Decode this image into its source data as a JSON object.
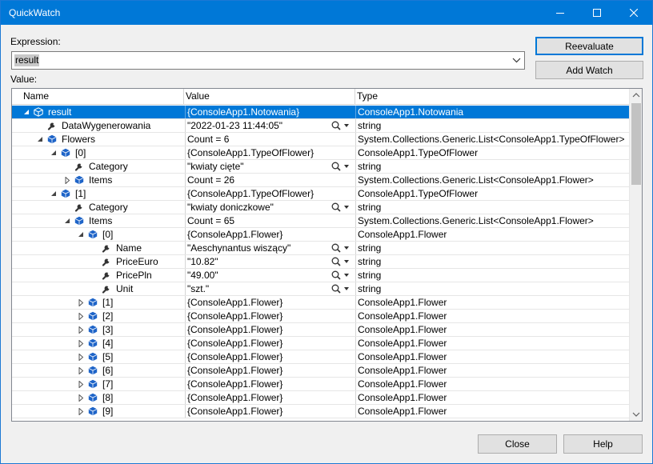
{
  "window": {
    "title": "QuickWatch"
  },
  "titlebar_icons": [
    "minimize-icon",
    "maximize-icon",
    "close-icon"
  ],
  "expression": {
    "label": "Expression:",
    "value": "result"
  },
  "value_label": "Value:",
  "buttons": {
    "reevaluate": "Reevaluate",
    "add_watch": "Add Watch",
    "close": "Close",
    "help": "Help"
  },
  "columns": {
    "name": "Name",
    "value": "Value",
    "type": "Type"
  },
  "colors": {
    "accent": "#0078d7",
    "field_icon": "#1e64c8"
  },
  "rows": [
    {
      "name": "result",
      "value": "{ConsoleApp1.Notowania}",
      "type": "ConsoleApp1.Notowania",
      "level": 0,
      "expander": "expanded",
      "icon": "object",
      "selected": true
    },
    {
      "name": "DataWygenerowania",
      "value": "\"2022-01-23 11:44:05\"",
      "type": "string",
      "level": 1,
      "expander": "none",
      "icon": "property",
      "magnifier": true
    },
    {
      "name": "Flowers",
      "value": "Count = 6",
      "type": "System.Collections.Generic.List<ConsoleApp1.TypeOfFlower>",
      "level": 1,
      "expander": "expanded",
      "icon": "field"
    },
    {
      "name": "[0]",
      "value": "{ConsoleApp1.TypeOfFlower}",
      "type": "ConsoleApp1.TypeOfFlower",
      "level": 2,
      "expander": "expanded",
      "icon": "field"
    },
    {
      "name": "Category",
      "value": "\"kwiaty cięte\"",
      "type": "string",
      "level": 3,
      "expander": "none",
      "icon": "property",
      "magnifier": true
    },
    {
      "name": "Items",
      "value": "Count = 26",
      "type": "System.Collections.Generic.List<ConsoleApp1.Flower>",
      "level": 3,
      "expander": "collapsed",
      "icon": "field"
    },
    {
      "name": "[1]",
      "value": "{ConsoleApp1.TypeOfFlower}",
      "type": "ConsoleApp1.TypeOfFlower",
      "level": 2,
      "expander": "expanded",
      "icon": "field"
    },
    {
      "name": "Category",
      "value": "\"kwiaty doniczkowe\"",
      "type": "string",
      "level": 3,
      "expander": "none",
      "icon": "property",
      "magnifier": true
    },
    {
      "name": "Items",
      "value": "Count = 65",
      "type": "System.Collections.Generic.List<ConsoleApp1.Flower>",
      "level": 3,
      "expander": "expanded",
      "icon": "field"
    },
    {
      "name": "[0]",
      "value": "{ConsoleApp1.Flower}",
      "type": "ConsoleApp1.Flower",
      "level": 4,
      "expander": "expanded",
      "icon": "field"
    },
    {
      "name": "Name",
      "value": "\"Aeschynantus wiszący\"",
      "type": "string",
      "level": 5,
      "expander": "none",
      "icon": "property",
      "magnifier": true
    },
    {
      "name": "PriceEuro",
      "value": "\"10.82\"",
      "type": "string",
      "level": 5,
      "expander": "none",
      "icon": "property",
      "magnifier": true
    },
    {
      "name": "PricePln",
      "value": "\"49.00\"",
      "type": "string",
      "level": 5,
      "expander": "none",
      "icon": "property",
      "magnifier": true
    },
    {
      "name": "Unit",
      "value": "\"szt.\"",
      "type": "string",
      "level": 5,
      "expander": "none",
      "icon": "property",
      "magnifier": true
    },
    {
      "name": "[1]",
      "value": "{ConsoleApp1.Flower}",
      "type": "ConsoleApp1.Flower",
      "level": 4,
      "expander": "collapsed",
      "icon": "field"
    },
    {
      "name": "[2]",
      "value": "{ConsoleApp1.Flower}",
      "type": "ConsoleApp1.Flower",
      "level": 4,
      "expander": "collapsed",
      "icon": "field"
    },
    {
      "name": "[3]",
      "value": "{ConsoleApp1.Flower}",
      "type": "ConsoleApp1.Flower",
      "level": 4,
      "expander": "collapsed",
      "icon": "field"
    },
    {
      "name": "[4]",
      "value": "{ConsoleApp1.Flower}",
      "type": "ConsoleApp1.Flower",
      "level": 4,
      "expander": "collapsed",
      "icon": "field"
    },
    {
      "name": "[5]",
      "value": "{ConsoleApp1.Flower}",
      "type": "ConsoleApp1.Flower",
      "level": 4,
      "expander": "collapsed",
      "icon": "field"
    },
    {
      "name": "[6]",
      "value": "{ConsoleApp1.Flower}",
      "type": "ConsoleApp1.Flower",
      "level": 4,
      "expander": "collapsed",
      "icon": "field"
    },
    {
      "name": "[7]",
      "value": "{ConsoleApp1.Flower}",
      "type": "ConsoleApp1.Flower",
      "level": 4,
      "expander": "collapsed",
      "icon": "field"
    },
    {
      "name": "[8]",
      "value": "{ConsoleApp1.Flower}",
      "type": "ConsoleApp1.Flower",
      "level": 4,
      "expander": "collapsed",
      "icon": "field"
    },
    {
      "name": "[9]",
      "value": "{ConsoleApp1.Flower}",
      "type": "ConsoleApp1.Flower",
      "level": 4,
      "expander": "collapsed",
      "icon": "field"
    }
  ]
}
